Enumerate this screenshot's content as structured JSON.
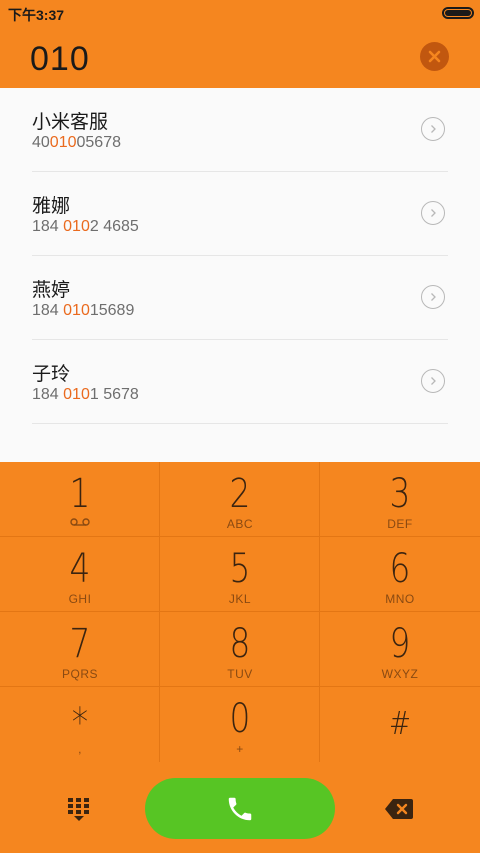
{
  "status": {
    "time": "下午3:37"
  },
  "dialer": {
    "number": "010"
  },
  "contacts": [
    {
      "name": "小米客服",
      "pre": "40",
      "match": "010",
      "post": "05678"
    },
    {
      "name": "雅娜",
      "pre": "184 ",
      "match": "010",
      "post": "2 4685"
    },
    {
      "name": "燕婷",
      "pre": "184 ",
      "match": "010",
      "post": "15689"
    },
    {
      "name": "子玲",
      "pre": "184 ",
      "match": "010",
      "post": "1 5678"
    }
  ],
  "keys": [
    {
      "digit": "1",
      "letters": ""
    },
    {
      "digit": "2",
      "letters": "ABC"
    },
    {
      "digit": "3",
      "letters": "DEF"
    },
    {
      "digit": "4",
      "letters": "GHI"
    },
    {
      "digit": "5",
      "letters": "JKL"
    },
    {
      "digit": "6",
      "letters": "MNO"
    },
    {
      "digit": "7",
      "letters": "PQRS"
    },
    {
      "digit": "8",
      "letters": "TUV"
    },
    {
      "digit": "9",
      "letters": "WXYZ"
    },
    {
      "digit": "*",
      "letters": ","
    },
    {
      "digit": "0",
      "letters": "+"
    },
    {
      "digit": "#",
      "letters": ""
    }
  ],
  "icons": {
    "voicemail": "voicemail-icon",
    "clear": "close-circle-icon",
    "detail": "chevron-right-icon",
    "call": "phone-icon",
    "dialpad": "dialpad-icon",
    "backspace": "backspace-icon"
  },
  "colors": {
    "accent": "#f5861f",
    "call": "#57c524",
    "highlight": "#ea6a1e"
  }
}
